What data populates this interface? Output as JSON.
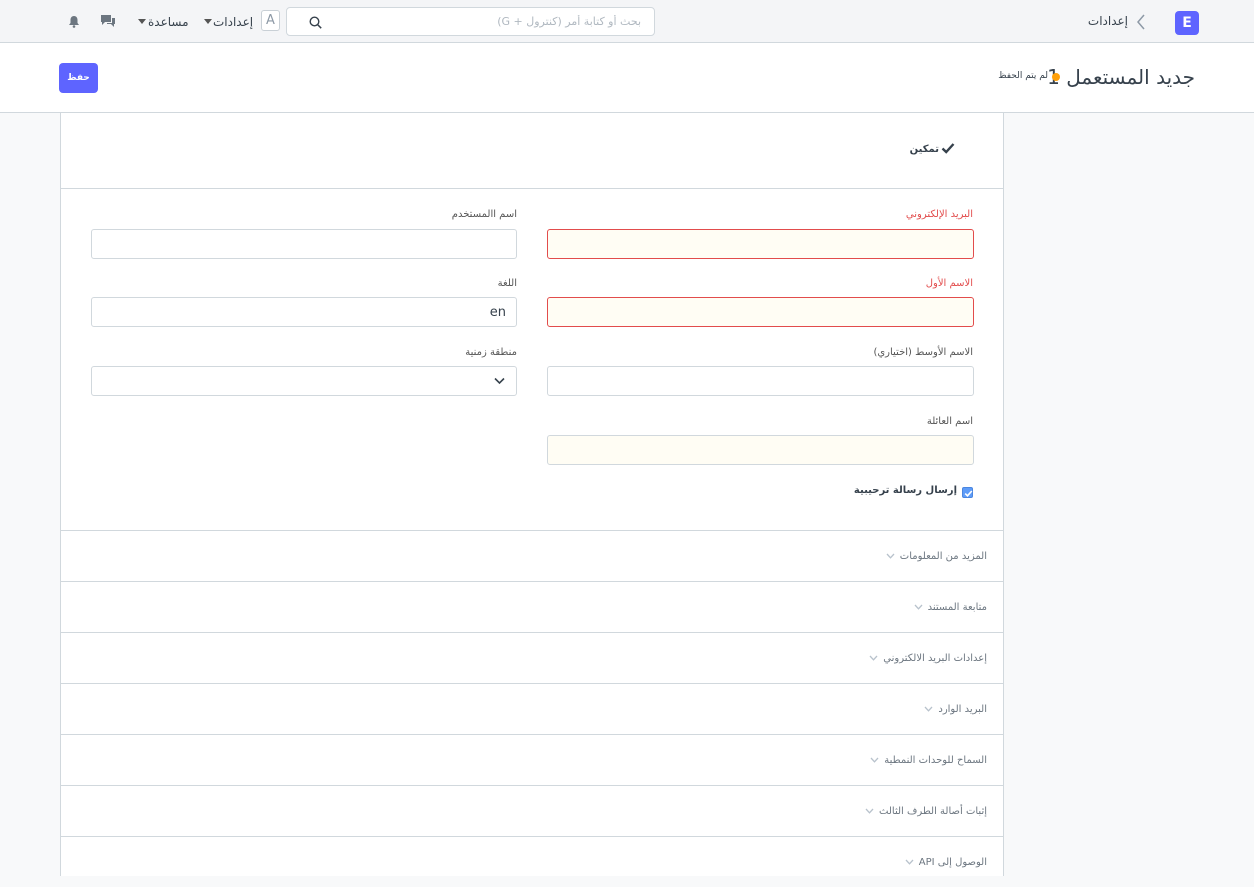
{
  "navbar": {
    "brand_letter": "E",
    "breadcrumb": "إعدادات",
    "search_placeholder": "بحث أو كتابة أمر (كنترول + G)",
    "avatar_letter": "A",
    "settings_label": "إعدادات",
    "help_label": "مساعدة"
  },
  "page": {
    "title": "جديد المستعمل 1",
    "indicator": "لم يتم الحفظ",
    "save_label": "حفظ"
  },
  "form": {
    "enabled_label": "تمكين",
    "email_label": "البريد الإلكتروني",
    "username_label": "اسم االمستخدم",
    "first_name_label": "الاسم الأول",
    "language_label": "اللغة",
    "language_value": "en",
    "middle_name_label": "الاسم الأوسط (اختياري)",
    "timezone_label": "منطقة زمنية",
    "last_name_label": "اسم العائلة",
    "send_welcome_label": "إرسال رسالة ترحيبية",
    "send_welcome_checked": true
  },
  "sections": [
    {
      "title": "المزيد من المعلومات"
    },
    {
      "title": "متابعة المستند"
    },
    {
      "title": "إعدادات البريد الالكتروني"
    },
    {
      "title": "البريد الوارد"
    },
    {
      "title": "السماح للوحدات النمطية"
    },
    {
      "title": "إثبات أصالة الطرف الثالث"
    },
    {
      "title": "الوصول إلى API"
    }
  ]
}
